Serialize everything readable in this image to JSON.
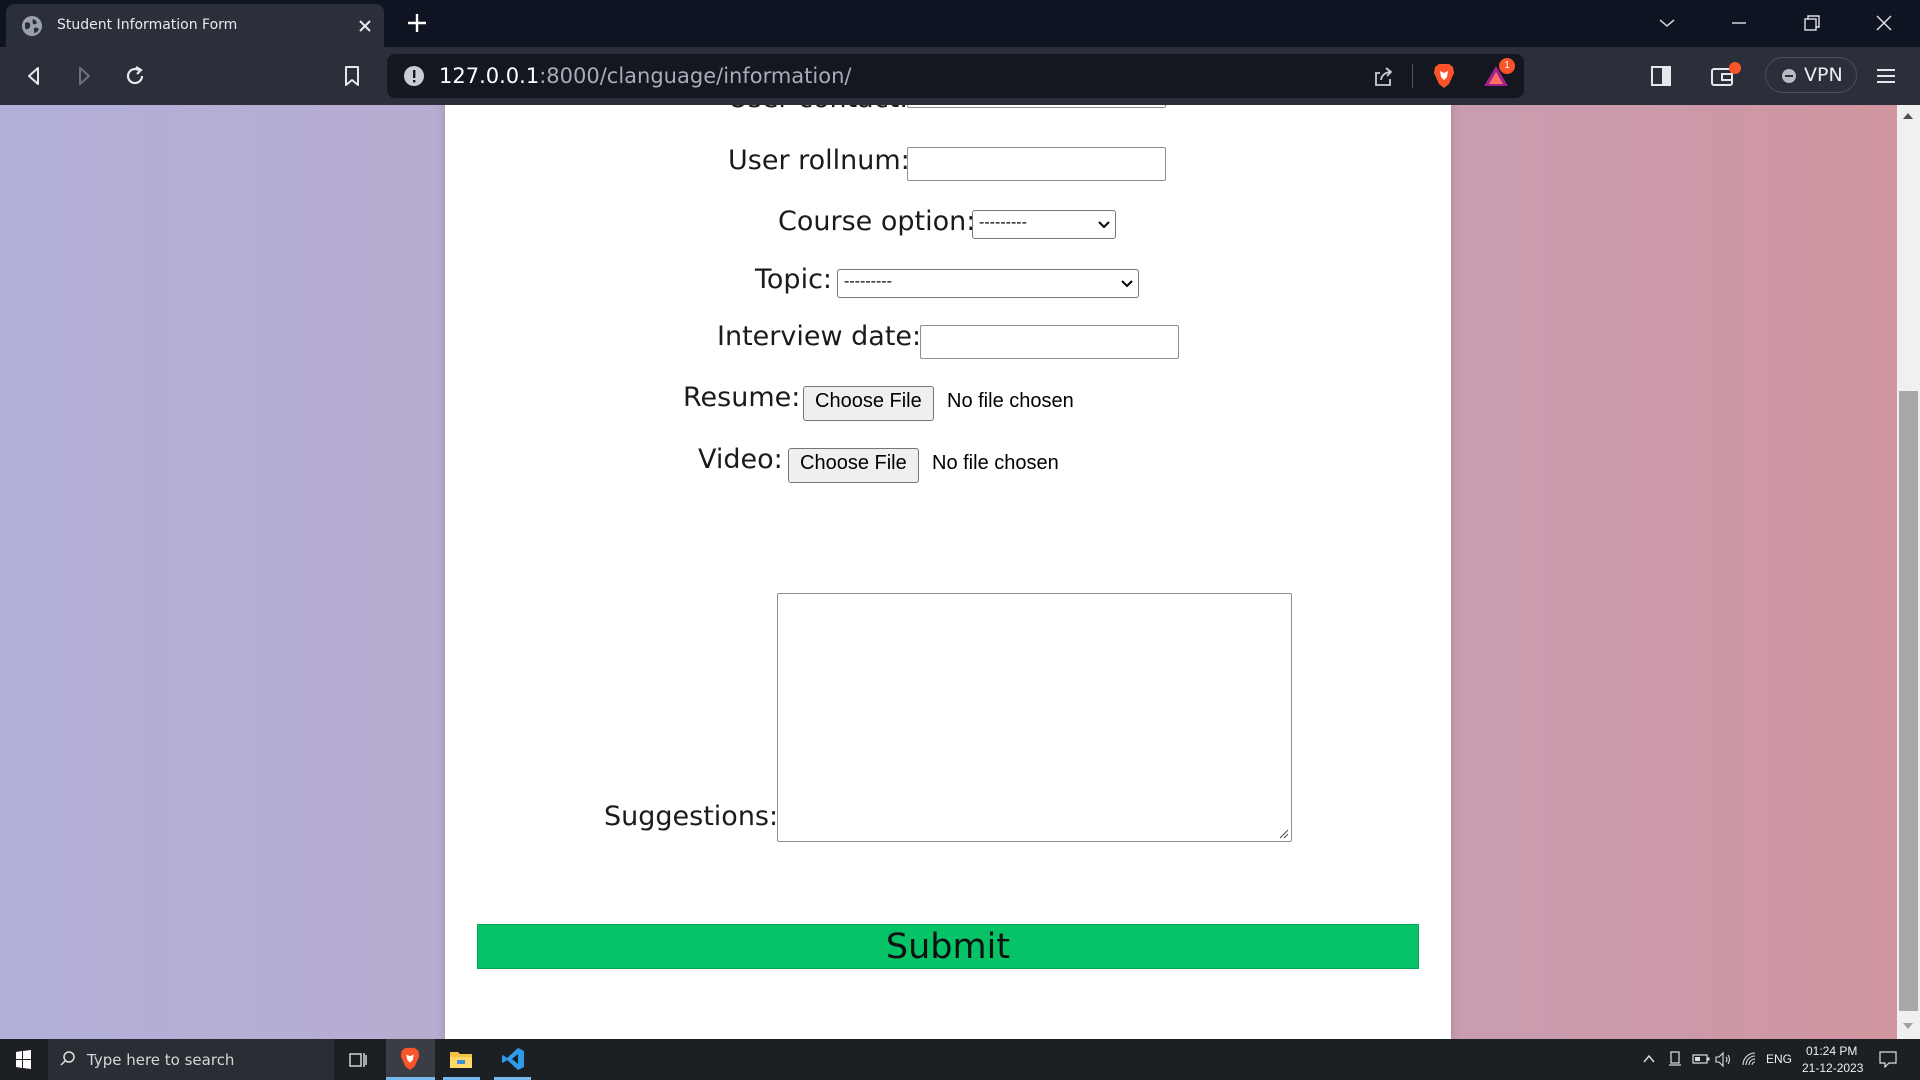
{
  "browser": {
    "tab_title": "Student Information Form",
    "url_host": "127.0.0.1",
    "url_path": ":8000/clanguage/information/",
    "rewards_badge": "1",
    "vpn_label": "VPN"
  },
  "form": {
    "contact_label": "User contact:",
    "rollnum_label": "User rollnum:",
    "course_label": "Course option:",
    "course_value": "---------",
    "topic_label": "Topic:",
    "topic_value": "---------",
    "date_label": "Interview date:",
    "resume_label": "Resume:",
    "video_label": "Video:",
    "choose_file": "Choose File",
    "no_file": "No file chosen",
    "suggestions_label": "Suggestions:",
    "submit_label": "Submit"
  },
  "taskbar": {
    "search_placeholder": "Type here to search",
    "language": "ENG",
    "time": "01:24 PM",
    "date": "21-12-2023"
  },
  "colors": {
    "submit_bg": "#06c368",
    "page_gradient_left": "#b2b0d9",
    "page_gradient_right": "#d0959f",
    "brave_orange": "#fb542b"
  }
}
